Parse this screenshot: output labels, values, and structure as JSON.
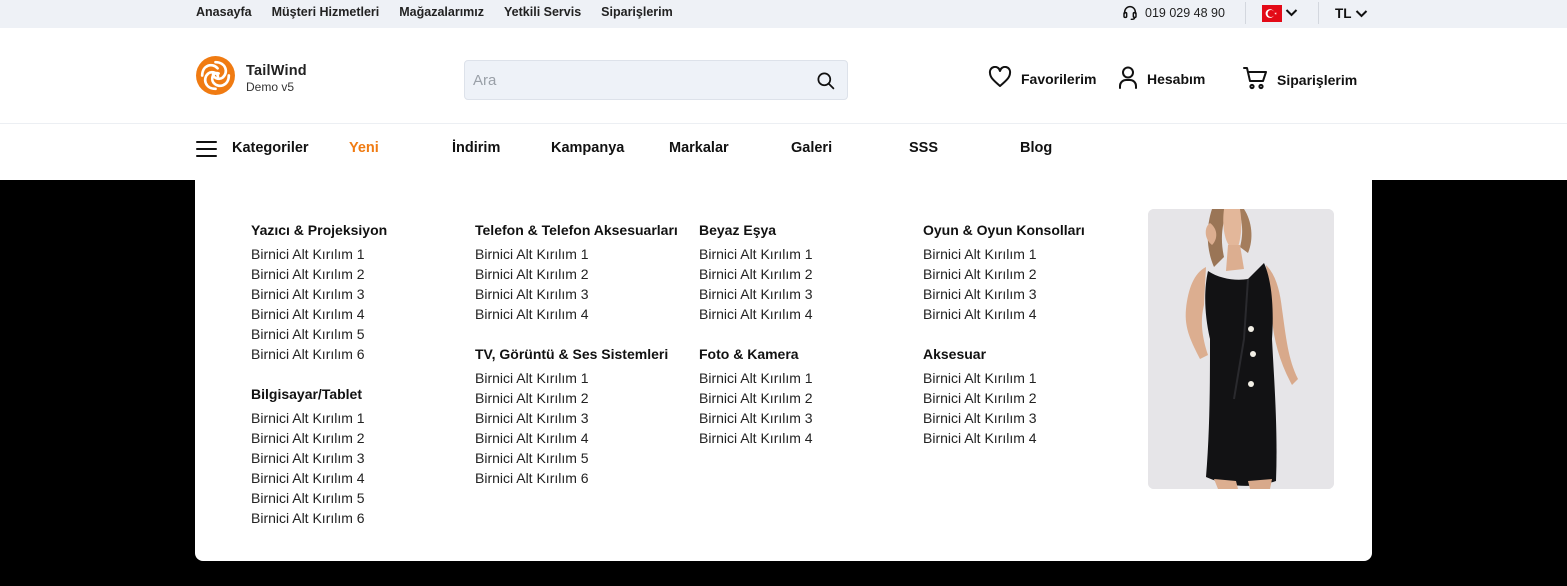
{
  "topbar": {
    "links": [
      "Anasayfa",
      "Müşteri Hizmetleri",
      "Mağazalarımız",
      "Yetkili Servis",
      "Siparişlerim"
    ],
    "phone": "019 029 48 90",
    "currency": "TL",
    "flag_icon": "turkey-flag-icon"
  },
  "header": {
    "logo_title": "TailWind",
    "logo_subtitle": "Demo v5",
    "search_placeholder": "Ara",
    "favorites_label": "Favorilerim",
    "account_label": "Hesabım",
    "orders_label": "Siparişlerim",
    "accent_color": "#f07b12"
  },
  "nav": {
    "categories_label": "Kategoriler",
    "items": [
      "Yeni",
      "İndirim",
      "Kampanya",
      "Markalar",
      "Galeri",
      "SSS",
      "Blog"
    ],
    "active_item": "Yeni"
  },
  "mega_menu": {
    "columns": [
      [
        {
          "title": "Yazıcı & Projeksiyon",
          "links": [
            "Birnici Alt Kırılım 1",
            "Birnici Alt Kırılım 2",
            "Birnici Alt Kırılım 3",
            "Birnici Alt Kırılım 4",
            "Birnici Alt Kırılım 5",
            "Birnici Alt Kırılım 6"
          ]
        },
        {
          "title": "Bilgisayar/Tablet",
          "links": [
            "Birnici Alt Kırılım 1",
            "Birnici Alt Kırılım 2",
            "Birnici Alt Kırılım 3",
            "Birnici Alt Kırılım 4",
            "Birnici Alt Kırılım 5",
            "Birnici Alt Kırılım 6"
          ]
        }
      ],
      [
        {
          "title": "Telefon & Telefon Aksesuarları",
          "links": [
            "Birnici Alt Kırılım 1",
            "Birnici Alt Kırılım 2",
            "Birnici Alt Kırılım 3",
            "Birnici Alt Kırılım 4"
          ]
        },
        {
          "title": "TV, Görüntü & Ses Sistemleri",
          "links": [
            "Birnici Alt Kırılım 1",
            "Birnici Alt Kırılım 2",
            "Birnici Alt Kırılım 3",
            "Birnici Alt Kırılım 4",
            "Birnici Alt Kırılım 5",
            "Birnici Alt Kırılım 6"
          ]
        }
      ],
      [
        {
          "title": "Beyaz Eşya",
          "links": [
            "Birnici Alt Kırılım 1",
            "Birnici Alt Kırılım 2",
            "Birnici Alt Kırılım 3",
            "Birnici Alt Kırılım 4"
          ]
        },
        {
          "title": "Foto & Kamera",
          "links": [
            "Birnici Alt Kırılım 1",
            "Birnici Alt Kırılım 2",
            "Birnici Alt Kırılım 3",
            "Birnici Alt Kırılım 4"
          ]
        }
      ],
      [
        {
          "title": "Oyun & Oyun Konsolları",
          "links": [
            "Birnici Alt Kırılım 1",
            "Birnici Alt Kırılım 2",
            "Birnici Alt Kırılım 3",
            "Birnici Alt Kırılım 4"
          ]
        },
        {
          "title": "Aksesuar",
          "links": [
            "Birnici Alt Kırılım 1",
            "Birnici Alt Kırılım 2",
            "Birnici Alt Kırılım 3",
            "Birnici Alt Kırılım 4"
          ]
        }
      ]
    ]
  }
}
